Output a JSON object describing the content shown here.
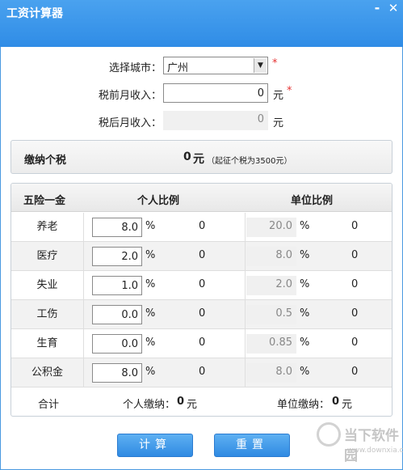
{
  "window": {
    "title": "工资计算器",
    "min_glyph": "-",
    "close_glyph": "✕"
  },
  "form": {
    "city_label": "选择城市：",
    "city_value": "广州",
    "required_mark": "*",
    "pretax_label": "税前月收入：",
    "pretax_value": "0",
    "unit_yuan": "元",
    "aftertax_label": "税后月收入：",
    "aftertax_value": "0"
  },
  "tax": {
    "label": "缴纳个税",
    "value": "0",
    "unit": "元",
    "note": "（起征个税为3500元）"
  },
  "table": {
    "headers": {
      "name": "五险一金",
      "personal": "个人比例",
      "company": "单位比例"
    },
    "percent": "%",
    "rows": [
      {
        "name": "养老",
        "personal_rate": "8.0",
        "personal_amount": "0",
        "company_rate": "20.0",
        "company_amount": "0"
      },
      {
        "name": "医疗",
        "personal_rate": "2.0",
        "personal_amount": "0",
        "company_rate": "8.0",
        "company_amount": "0"
      },
      {
        "name": "失业",
        "personal_rate": "1.0",
        "personal_amount": "0",
        "company_rate": "2.0",
        "company_amount": "0"
      },
      {
        "name": "工伤",
        "personal_rate": "0.0",
        "personal_amount": "0",
        "company_rate": "0.5",
        "company_amount": "0"
      },
      {
        "name": "生育",
        "personal_rate": "0.0",
        "personal_amount": "0",
        "company_rate": "0.85",
        "company_amount": "0"
      },
      {
        "name": "公积金",
        "personal_rate": "8.0",
        "personal_amount": "0",
        "company_rate": "8.0",
        "company_amount": "0"
      }
    ],
    "footer": {
      "total_label": "合计",
      "personal_label": "个人缴纳：",
      "personal_value": "0",
      "company_label": "单位缴纳：",
      "company_value": "0",
      "unit": "元"
    }
  },
  "buttons": {
    "calc": "计算",
    "reset": "重置"
  },
  "watermark": {
    "cn": "当下软件园",
    "en": "www.downxia.com"
  },
  "colors": {
    "titlebar": "#3a96ea",
    "button": "#3a96ea",
    "required": "#e53333"
  }
}
